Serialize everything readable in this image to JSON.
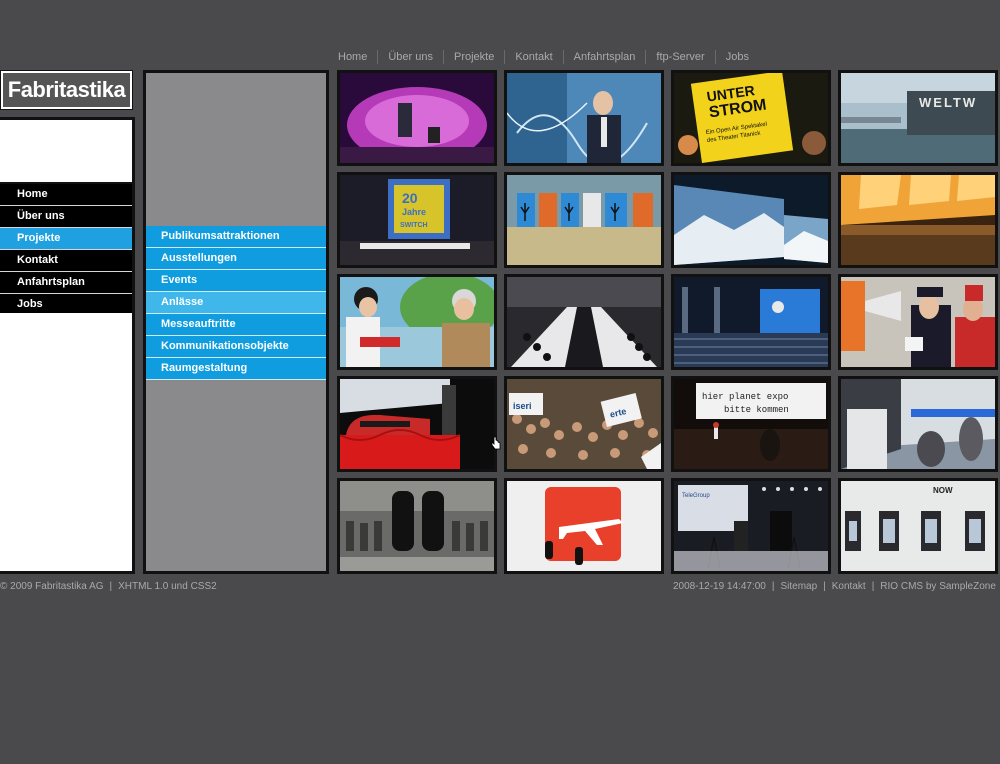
{
  "top_nav": [
    "Home",
    "Über uns",
    "Projekte",
    "Kontakt",
    "Anfahrtsplan",
    "ftp-Server",
    "Jobs"
  ],
  "logo": {
    "text": "Fabritastika"
  },
  "main_nav": [
    {
      "label": "Home",
      "active": false
    },
    {
      "label": "Über uns",
      "active": false
    },
    {
      "label": "Projekte",
      "active": true
    },
    {
      "label": "Kontakt",
      "active": false
    },
    {
      "label": "Anfahrtsplan",
      "active": false
    },
    {
      "label": "Jobs",
      "active": false
    }
  ],
  "sub_nav": [
    {
      "label": "Publikumsattraktionen",
      "hover": false
    },
    {
      "label": "Ausstellungen",
      "hover": false
    },
    {
      "label": "Events",
      "hover": false
    },
    {
      "label": "Anlässe",
      "hover": true
    },
    {
      "label": "Messeauftritte",
      "hover": false
    },
    {
      "label": "Kommunikationsobjekte",
      "hover": false
    },
    {
      "label": "Raumgestaltung",
      "hover": false
    }
  ],
  "thumbnails": {
    "t3_line1": "UNTER",
    "t3_line2": "STROM",
    "t3_line3": "Ein Open Air Spektakel",
    "t3_line4": "des Theater Titanick",
    "t4_text": "WELTW",
    "t5_line1": "20",
    "t5_line2": "Jahre",
    "t5_line3": "SWITCH",
    "t14_text": "iseri",
    "t14_text2": "erte",
    "t15_line1": "hier planet expo",
    "t15_line2": "bitte kommen",
    "t19_text": "TeleGroup",
    "t20_text": "NOW"
  },
  "footer": {
    "copyright": "© 2009 Fabritastika AG",
    "sep": "|",
    "standards": "XHTML 1.0 und CSS2",
    "timestamp": "2008-12-19 14:47:00",
    "sitemap": "Sitemap",
    "kontakt": "Kontakt",
    "cms": "RIO CMS by SampleZone"
  },
  "colors": {
    "background": "#4a4a4c",
    "accent_blue": "#0f9de0",
    "active_blue": "#1fa0e0",
    "hover_blue": "#3fb7ea"
  }
}
